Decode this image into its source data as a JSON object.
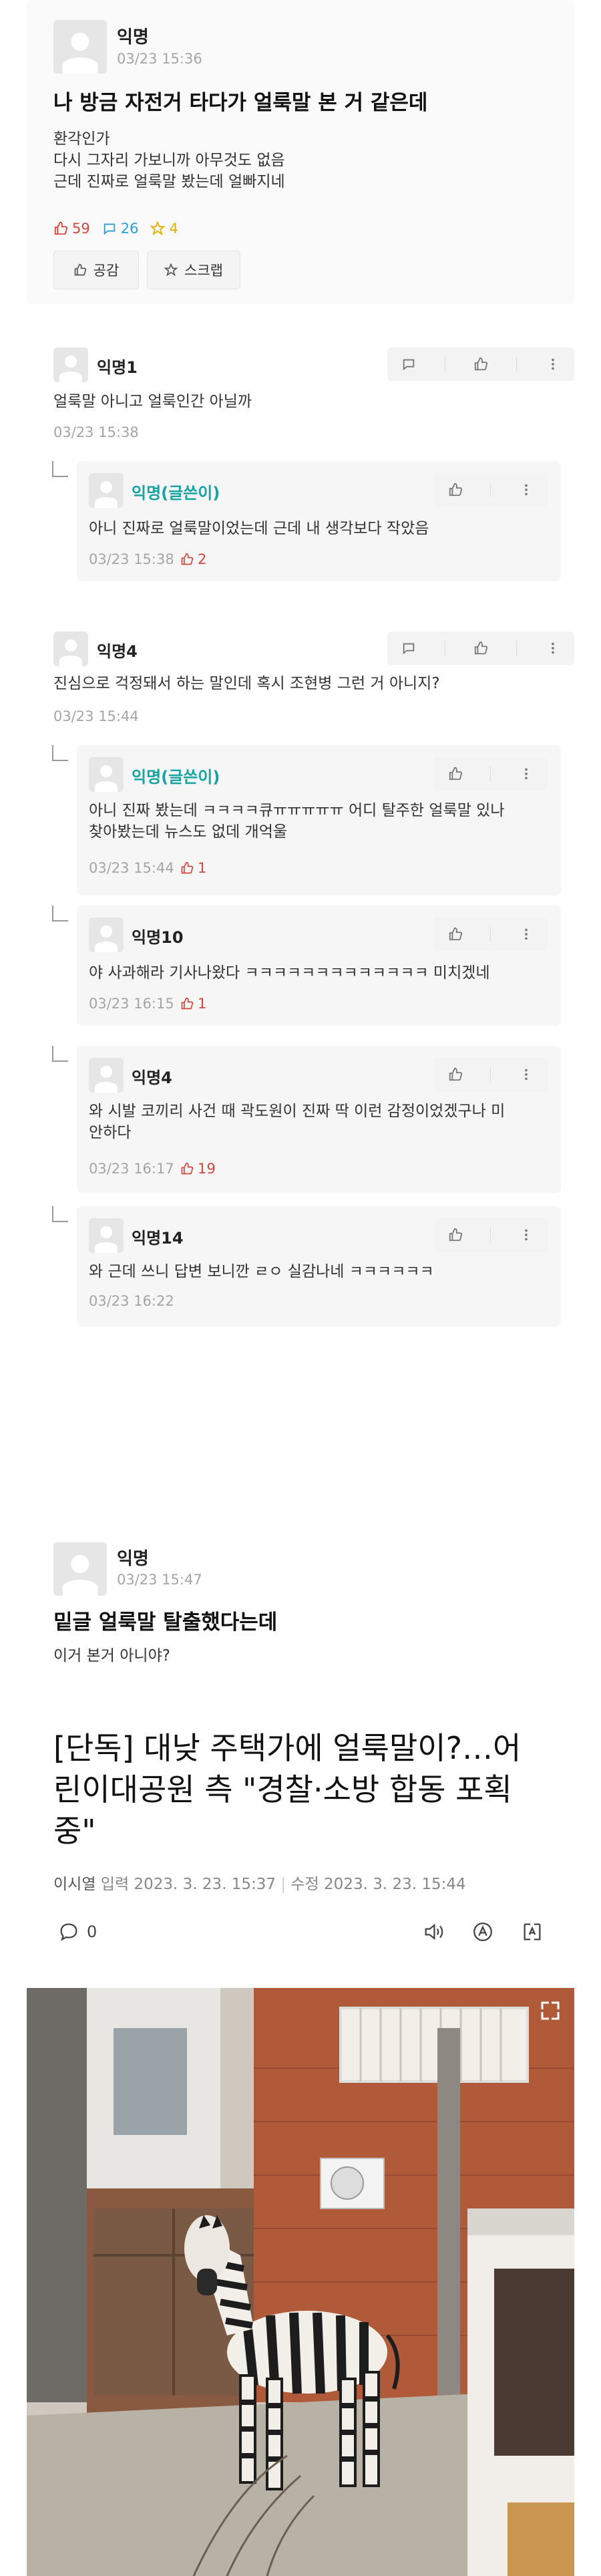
{
  "post1": {
    "author": "익명",
    "time": "03/23 15:36",
    "title": "나 방금 자전거 타다가 얼룩말 본 거 같은데",
    "body": "환각인가\n다시 그자리 가보니까 아무것도 없음\n근데 진짜로 얼룩말 봤는데 얼빠지네",
    "likes": "59",
    "comments": "26",
    "scraps": "4",
    "like_button": "공감",
    "scrap_button": "스크랩"
  },
  "comments": [
    {
      "author": "익명1",
      "text": "얼룩말 아니고 얼룩인간 아닐까",
      "time": "03/23 15:38",
      "replies": [
        {
          "author": "익명(글쓴이)",
          "text": "아니 진짜로 얼룩말이었는데 근데 내 생각보다 작았음",
          "time": "03/23 15:38",
          "likes": "2"
        }
      ]
    },
    {
      "author": "익명4",
      "text": "진심으로 걱정돼서 하는 말인데 혹시 조현병 그런 거 아니지?",
      "time": "03/23 15:44",
      "replies": [
        {
          "author": "익명(글쓴이)",
          "text": "아니 진짜 봤는데 ㅋㅋㅋㅋ큐ㅠㅠㅠㅠㅠ 어디 탈주한 얼룩말 있나\n찾아봤는데 뉴스도 없데 개억울",
          "time": "03/23 15:44",
          "likes": "1"
        },
        {
          "author": "익명10",
          "text": "야 사과해라 기사나왔다 ㅋㅋㅋㅋㅋㅋㅋㅋㅋㅋㅋㅋㅋ 미치겠네",
          "time": "03/23 16:15",
          "likes": "1"
        },
        {
          "author": "익명4",
          "text": "와 시발 코끼리 사건 때 곽도원이 진짜 딱 이런 감정이었겠구나 미\n안하다",
          "time": "03/23 16:17",
          "likes": "19"
        },
        {
          "author": "익명14",
          "text": "와 근데 쓰니 답변 보니깐 ㄹㅇ 실감나네 ㅋㅋㅋㅋㅋㅋ",
          "time": "03/23 16:22",
          "likes": ""
        }
      ]
    }
  ],
  "post2": {
    "author": "익명",
    "time": "03/23 15:47",
    "title": "밑글 얼룩말 탈출했다는데",
    "body": "이거 본거 아니야?"
  },
  "article": {
    "title": "[단독] 대낮 주택가에 얼룩말이?…어린이대공원 측 \"경찰·소방 합동 포획 중\"",
    "reporter": "이시열",
    "input_label": "입력",
    "input_time": "2023. 3. 23. 15:37",
    "edit_label": "수정",
    "edit_time": "2023. 3. 23. 15:44",
    "comment_count": "0"
  },
  "colors": {
    "like": "#d2463c",
    "comment": "#2a9fd6",
    "scrap": "#e1b000",
    "author": "#16a3a3"
  },
  "icons": [
    "thumbs-up-icon",
    "speech-bubble-icon",
    "star-icon",
    "more-icon",
    "reply-arrow-icon",
    "speaker-icon",
    "font-size-icon",
    "translate-icon",
    "expand-icon"
  ]
}
